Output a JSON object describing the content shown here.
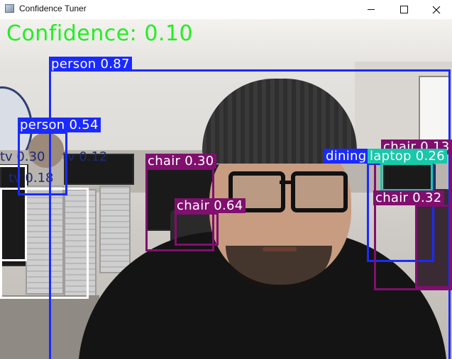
{
  "window": {
    "title": "Confidence Tuner",
    "icon": "app-window-icon"
  },
  "overlay": {
    "confidence_text": "Confidence: 0.10",
    "confidence_color": "#22ee22"
  },
  "colors": {
    "person": "#1a2aff",
    "chair": "#800f6e",
    "tv": "#ffffff",
    "laptop": "#18c8a8",
    "dining": "#1a2aff"
  },
  "detections": [
    {
      "label": "person 0.87"
    },
    {
      "label": "person 0.54"
    },
    {
      "label": "tv 0.30"
    },
    {
      "label": "tv 0.12"
    },
    {
      "label": "tv 0.18"
    },
    {
      "label": "chair 0.30"
    },
    {
      "label": "chair 0.64"
    },
    {
      "label": "dining"
    },
    {
      "label": "laptop 0.26"
    },
    {
      "label": "chair 0.13"
    },
    {
      "label": "chair 0.32"
    }
  ]
}
